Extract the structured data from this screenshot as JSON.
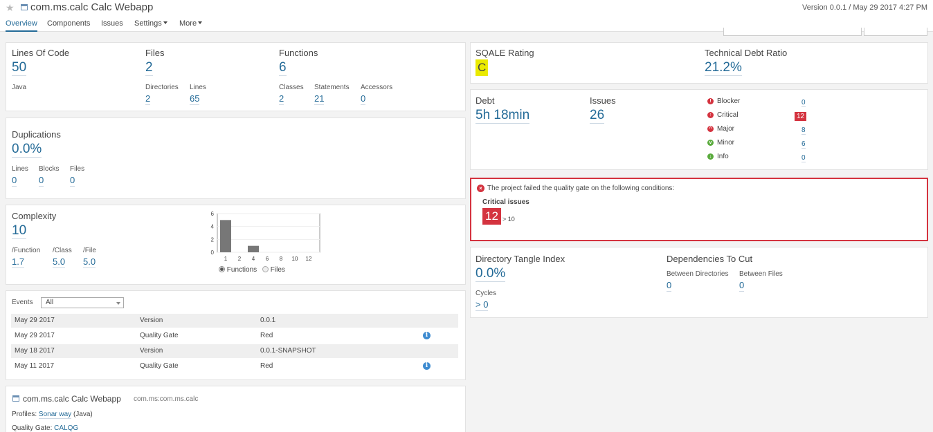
{
  "header": {
    "project_title": "com.ms.calc Calc Webapp",
    "version_info": "Version 0.0.1 / May 29 2017 4:27 PM",
    "tabs": [
      "Overview",
      "Components",
      "Issues",
      "Settings",
      "More"
    ]
  },
  "size": {
    "lines_of_code_label": "Lines Of Code",
    "lines_of_code": "50",
    "language": "Java",
    "files_label": "Files",
    "files": "2",
    "directories_label": "Directories",
    "directories": "2",
    "lines_label": "Lines",
    "lines": "65",
    "functions_label": "Functions",
    "functions": "6",
    "classes_label": "Classes",
    "classes": "2",
    "statements_label": "Statements",
    "statements": "21",
    "accessors_label": "Accessors",
    "accessors": "0"
  },
  "duplications": {
    "title": "Duplications",
    "value": "0.0%",
    "lines_label": "Lines",
    "lines": "0",
    "blocks_label": "Blocks",
    "blocks": "0",
    "files_label": "Files",
    "files": "0"
  },
  "complexity": {
    "title": "Complexity",
    "value": "10",
    "per_function_label": "/Function",
    "per_function": "1.7",
    "per_class_label": "/Class",
    "per_class": "5.0",
    "per_file_label": "/File",
    "per_file": "5.0",
    "radio_functions": "Functions",
    "radio_files": "Files"
  },
  "chart_data": {
    "type": "bar",
    "categories": [
      "1",
      "2",
      "4",
      "6",
      "8",
      "10",
      "12"
    ],
    "values": [
      5,
      0,
      1,
      0,
      0,
      0,
      0
    ],
    "ylim": [
      0,
      6
    ],
    "yticks": [
      "0",
      "2",
      "4",
      "6"
    ]
  },
  "events": {
    "label": "Events",
    "filter_value": "All",
    "rows": [
      {
        "date": "May 29 2017",
        "type": "Version",
        "value": "0.0.1"
      },
      {
        "date": "May 29 2017",
        "type": "Quality Gate",
        "value": "Red"
      },
      {
        "date": "May 18 2017",
        "type": "Version",
        "value": "0.0.1-SNAPSHOT"
      },
      {
        "date": "May 11 2017",
        "type": "Quality Gate",
        "value": "Red"
      }
    ]
  },
  "project_info": {
    "name": "com.ms.calc Calc Webapp",
    "key": "com.ms:com.ms.calc",
    "profiles_label": "Profiles:",
    "profile_name": "Sonar way",
    "profile_lang": "(Java)",
    "qg_label": "Quality Gate:",
    "qg_name": "CALQG"
  },
  "sqale": {
    "rating_label": "SQALE Rating",
    "rating": "C",
    "ratio_label": "Technical Debt Ratio",
    "ratio": "21.2%"
  },
  "debt": {
    "debt_label": "Debt",
    "debt": "5h 18min",
    "issues_label": "Issues",
    "issues": "26",
    "severities": [
      {
        "label": "Blocker",
        "count": "0"
      },
      {
        "label": "Critical",
        "count": "12"
      },
      {
        "label": "Major",
        "count": "8"
      },
      {
        "label": "Minor",
        "count": "6"
      },
      {
        "label": "Info",
        "count": "0"
      }
    ]
  },
  "quality_gate": {
    "message": "The project failed the quality gate on the following conditions:",
    "condition": "Critical issues",
    "value": "12",
    "threshold": "> 10"
  },
  "tangle": {
    "title": "Directory Tangle Index",
    "value": "0.0%",
    "cycles_label": "Cycles",
    "cycles": "> 0",
    "deps_title": "Dependencies To Cut",
    "between_dirs_label": "Between Directories",
    "between_dirs": "0",
    "between_files_label": "Between Files",
    "between_files": "0"
  },
  "colors": {
    "accent": "#236a97",
    "error": "#d4333f",
    "rating": "#eaea00"
  }
}
